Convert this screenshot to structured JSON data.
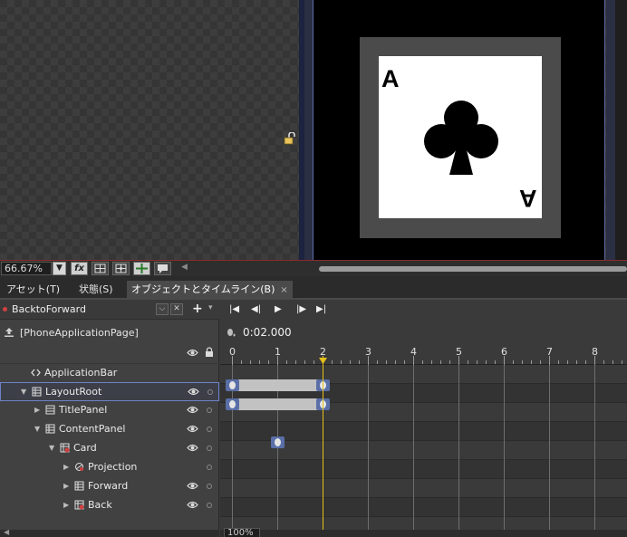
{
  "artboard": {
    "card": {
      "rank_top": "A",
      "rank_bottom": "A",
      "suit_icon": "club-icon",
      "face_color": "#ffffff",
      "frame_color": "#4b4b4b"
    },
    "marker_icon": "lock-open-icon"
  },
  "artboard_toolbar": {
    "zoom_value": "66.67%",
    "buttons": [
      {
        "icon": "fx-icon",
        "label": "fx"
      },
      {
        "icon": "grid-icon",
        "label": ""
      },
      {
        "icon": "snap-grid-icon",
        "label": ""
      },
      {
        "icon": "snap-lines-icon",
        "label": ""
      },
      {
        "icon": "annotation-icon",
        "label": ""
      }
    ]
  },
  "tabs": [
    {
      "label": "アセット(T)",
      "active": false
    },
    {
      "label": "状態(S)",
      "active": false
    },
    {
      "label": "オブジェクトとタイムライン(B)",
      "active": true,
      "close": "×"
    }
  ],
  "objects": {
    "storyboard": "BacktoForward",
    "page": "[PhoneApplicationPage]",
    "tree": [
      {
        "label": "ApplicationBar",
        "indent": 0,
        "twisty": "",
        "icon": "code-icon",
        "eye": false
      },
      {
        "label": "LayoutRoot",
        "indent": 0,
        "twisty": "▼",
        "icon": "grid-icon",
        "eye": true,
        "selected": true
      },
      {
        "label": "TitlePanel",
        "indent": 1,
        "twisty": "▶",
        "icon": "stackpanel-icon",
        "eye": true
      },
      {
        "label": "ContentPanel",
        "indent": 1,
        "twisty": "▼",
        "icon": "grid-icon",
        "eye": true
      },
      {
        "label": "Card",
        "indent": 2,
        "twisty": "▼",
        "icon": "grid-red-icon",
        "eye": true
      },
      {
        "label": "Projection",
        "indent": 3,
        "twisty": "▶",
        "icon": "projection-icon",
        "eye": false
      },
      {
        "label": "Forward",
        "indent": 3,
        "twisty": "▶",
        "icon": "grid-icon",
        "eye": true
      },
      {
        "label": "Back",
        "indent": 3,
        "twisty": "▶",
        "icon": "grid-red-icon",
        "eye": true
      }
    ]
  },
  "timeline": {
    "current_time": "0:02.000",
    "ruler_labels": [
      "0",
      "1",
      "2",
      "3",
      "4",
      "5",
      "6",
      "7",
      "8"
    ],
    "playhead_seconds": 2,
    "zoom": "100%",
    "tracks": [
      {
        "name": "Card",
        "bar_start": 0,
        "bar_end": 2
      },
      {
        "name": "Projection",
        "bar_start": 0,
        "bar_end": 2
      },
      {
        "name": "Forward"
      },
      {
        "name": "Back",
        "key": 1
      }
    ],
    "accent_color": "#e6c01a",
    "keyframe_color": "#5a6fa8"
  }
}
